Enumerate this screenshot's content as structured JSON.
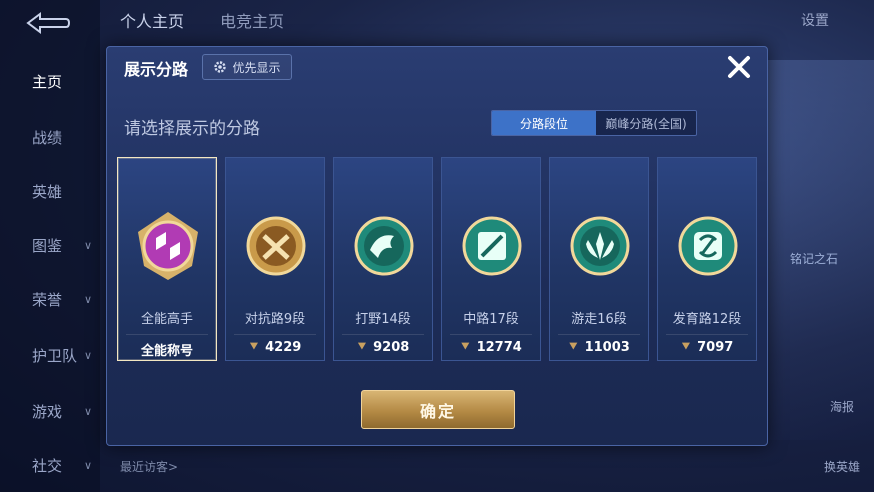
{
  "background": {
    "top_tabs": [
      "个人主页",
      "电竞主页"
    ],
    "settings_label": "设置",
    "sidebar": [
      {
        "label": "主页",
        "chevron": false
      },
      {
        "label": "战绩",
        "chevron": false
      },
      {
        "label": "英雄",
        "chevron": false
      },
      {
        "label": "图鉴",
        "chevron": true
      },
      {
        "label": "荣誉",
        "chevron": true
      },
      {
        "label": "护卫队",
        "chevron": true
      },
      {
        "label": "游戏",
        "chevron": true
      },
      {
        "label": "社交",
        "chevron": true
      }
    ],
    "recent_visitors": "最近访客>",
    "right_text": "铭记之石",
    "poster_label": "海报",
    "switch_hero_label": "换英雄"
  },
  "dialog": {
    "title": "展示分路",
    "pref_button": "优先显示",
    "subtitle": "请选择展示的分路",
    "toggle": {
      "active": "分路段位",
      "inactive": "巅峰分路(全国)"
    },
    "confirm_label": "确定",
    "accent": "#3d72c8",
    "cards": [
      {
        "name": "全能高手",
        "badge": "全能称号",
        "score": "",
        "selected": true,
        "emblem": "all-round-emblem",
        "color": "#b13bb4"
      },
      {
        "name": "对抗路9段",
        "badge": "",
        "score": "4229",
        "selected": false,
        "emblem": "clash-lane-emblem",
        "color": "#c9913a"
      },
      {
        "name": "打野14段",
        "badge": "",
        "score": "9208",
        "selected": false,
        "emblem": "jungle-emblem",
        "color": "#1f8a7a"
      },
      {
        "name": "中路17段",
        "badge": "",
        "score": "12774",
        "selected": false,
        "emblem": "mid-lane-emblem",
        "color": "#1f8a7a"
      },
      {
        "name": "游走16段",
        "badge": "",
        "score": "11003",
        "selected": false,
        "emblem": "roam-emblem",
        "color": "#1f8a7a"
      },
      {
        "name": "发育路12段",
        "badge": "",
        "score": "7097",
        "selected": false,
        "emblem": "farm-lane-emblem",
        "color": "#1f8a7a"
      }
    ]
  }
}
